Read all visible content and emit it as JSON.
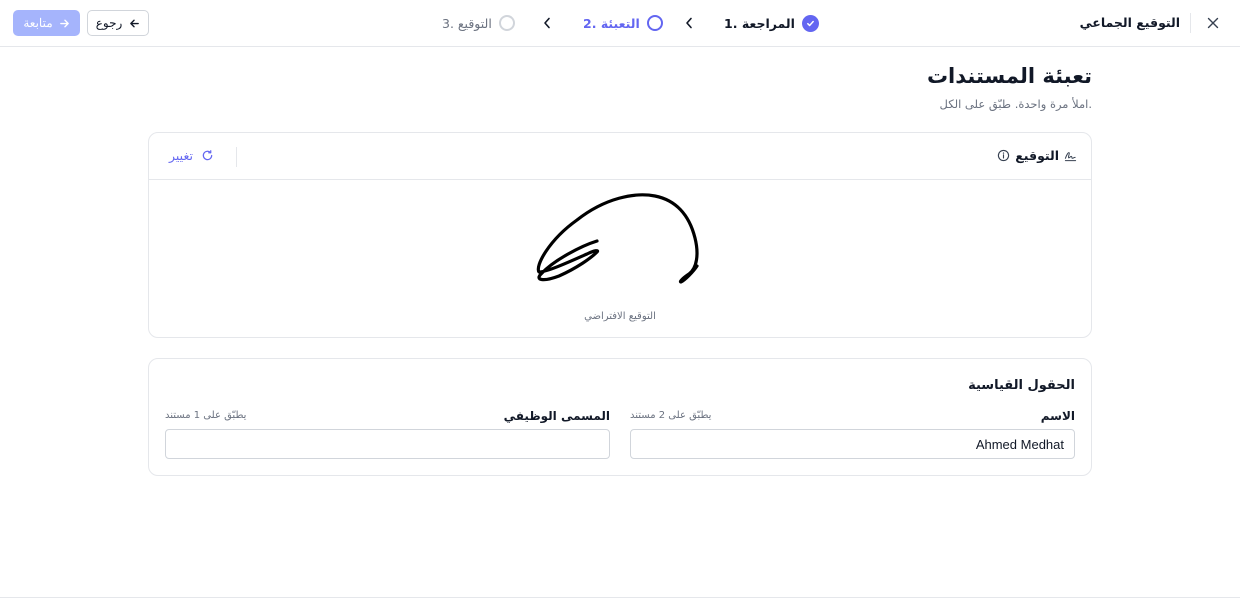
{
  "header": {
    "app_title": "التوقيع الجماعي",
    "continue_label": "متابعة",
    "back_label": "رجوع"
  },
  "steps": [
    {
      "label": "1. المراجعة",
      "state": "done"
    },
    {
      "label": "2. التعبئة",
      "state": "active"
    },
    {
      "label": "3. التوقيع",
      "state": "pending"
    }
  ],
  "page": {
    "title": "تعبئة المستندات",
    "subtitle": "املأ مرة واحدة. طبّق على الكل."
  },
  "signature": {
    "title": "التوقيع",
    "change_label": "تغيير",
    "caption": "التوقيع الافتراضي"
  },
  "standard_fields": {
    "title": "الحقول القياسية",
    "fields": [
      {
        "label": "الاسم",
        "applies": "يطبّق على 2 مستند",
        "value": "Ahmed Medhat",
        "placeholder": ""
      },
      {
        "label": "المسمى الوظيفي",
        "applies": "يطبّق على 1 مستند",
        "value": "",
        "placeholder": ""
      }
    ]
  },
  "colors": {
    "accent": "#6366f1",
    "accent_disabled": "#a5b4fc",
    "border": "#e5e7eb",
    "muted_text": "#6b7280"
  },
  "icons": [
    "arrow-right-icon",
    "arrow-left-icon",
    "chevron-left-icon",
    "check-icon",
    "close-icon",
    "signature-icon",
    "info-icon",
    "refresh-icon"
  ]
}
